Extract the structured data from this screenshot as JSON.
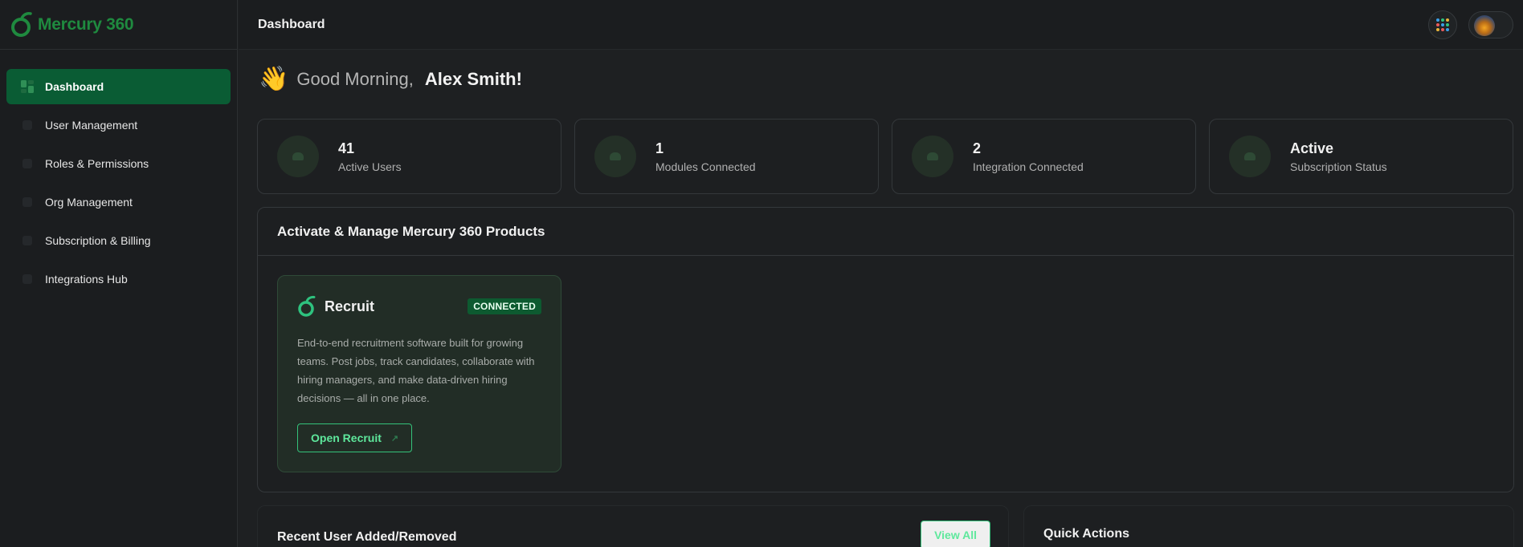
{
  "brand": {
    "name": "Mercury 360"
  },
  "sidebar": {
    "items": [
      {
        "label": "Dashboard",
        "active": true
      },
      {
        "label": "User Management"
      },
      {
        "label": "Roles & Permissions"
      },
      {
        "label": "Org Management"
      },
      {
        "label": "Subscription & Billing"
      },
      {
        "label": "Integrations Hub"
      }
    ]
  },
  "header": {
    "title": "Dashboard"
  },
  "greeting": {
    "emoji": "👋",
    "text": "Good Morning,",
    "name": "Alex Smith!"
  },
  "stats": [
    {
      "value": "41",
      "label": "Active Users"
    },
    {
      "value": "1",
      "label": "Modules Connected"
    },
    {
      "value": "2",
      "label": "Integration Connected"
    },
    {
      "value": "Active",
      "label": "Subscription Status"
    }
  ],
  "products": {
    "title": "Activate & Manage Mercury 360 Products",
    "items": [
      {
        "name": "Recruit",
        "badge": "CONNECTED",
        "description": "End-to-end recruitment software built for growing teams. Post jobs, track candidates, collaborate with hiring managers, and make data-driven hiring decisions — all in one place.",
        "button_label": "Open Recruit",
        "button_icon": "↗"
      }
    ]
  },
  "recent": {
    "title": "Recent User Added/Removed",
    "view_all_label": "View All"
  },
  "quick_actions": {
    "title": "Quick Actions"
  },
  "colors": {
    "accent": "#0a5c34",
    "brand": "#1f8a3f",
    "button_border": "#34c27a"
  },
  "icons": {
    "apps": "apps-grid-icon",
    "dashboard": "dashboard-icon",
    "external": "external-link-icon"
  }
}
